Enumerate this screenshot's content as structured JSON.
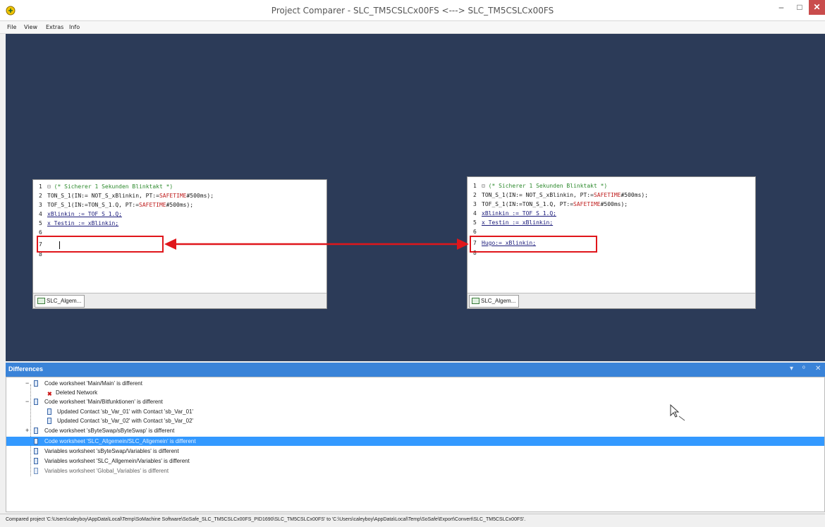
{
  "window": {
    "title": "Project Comparer - SLC_TM5CSLCx00FS <---> SLC_TM5CSLCx00FS",
    "min_icon": "minimize-icon",
    "max_icon": "maximize-icon",
    "close_icon": "close-icon"
  },
  "menu": {
    "items": [
      "File",
      "View",
      "Extras",
      "Info"
    ]
  },
  "left_editor": {
    "tab_label": "SLC_Algem...",
    "lines": [
      {
        "num": "1",
        "fold": "⊟",
        "text": "(* Sicherer 1 Sekunden Blinktakt *)"
      },
      {
        "num": "2",
        "code_a": "TON_S_1(IN:= NOT_S_xBlinkin, PT:=",
        "kw": "SAFETIME",
        "code_b": "#500ms);"
      },
      {
        "num": "3",
        "code_a": "TOF_S_1(IN:=TON_S_1.Q, PT:=",
        "kw": "SAFETIME",
        "code_b": "#500ms);"
      },
      {
        "num": "4",
        "text": "xBlinkin     := TOF_S_1.Q;"
      },
      {
        "num": "5",
        "text": "x_Testin     := xBlinkin;"
      },
      {
        "num": "6",
        "text": ""
      },
      {
        "num": "7",
        "text": ""
      },
      {
        "num": "8",
        "text": ""
      }
    ]
  },
  "right_editor": {
    "tab_label": "SLC_Algem...",
    "lines": [
      {
        "num": "1",
        "fold": "⊟",
        "text": "(* Sicherer 1 Sekunden Blinktakt *)"
      },
      {
        "num": "2",
        "code_a": "TON_S_1(IN:= NOT_S_xBlinkin, PT:=",
        "kw": "SAFETIME",
        "code_b": "#500ms);"
      },
      {
        "num": "3",
        "code_a": "TOF_S_1(IN:=TON_S_1.Q, PT:=",
        "kw": "SAFETIME",
        "code_b": "#500ms);"
      },
      {
        "num": "4",
        "text": "xBlinkin     := TOF_S_1.Q;"
      },
      {
        "num": "5",
        "text": "x_Testin     := xBlinkin;"
      },
      {
        "num": "6",
        "text": ""
      },
      {
        "num": "7",
        "text": "Hugo:= xBlinkin;"
      },
      {
        "num": "8",
        "text": ""
      }
    ]
  },
  "differences": {
    "title": "Differences",
    "controls": [
      "▾",
      "ᵒ",
      "✕"
    ],
    "rows": [
      {
        "toggle": "−",
        "icon": "doc",
        "text": "Code worksheet 'Main/Main' is different"
      },
      {
        "toggle": "",
        "icon": "error",
        "text": "Deleted Network"
      },
      {
        "toggle": "−",
        "icon": "doc",
        "text": "Code worksheet 'Main/Bitfunktionen' is different"
      },
      {
        "toggle": "",
        "icon": "doc",
        "text": "Updated Contact 'sb_Var_01' with Contact 'sb_Var_01'"
      },
      {
        "toggle": "",
        "icon": "doc",
        "text": "Updated Contact 'sb_Var_02' with Contact 'sb_Var_02'"
      },
      {
        "toggle": "+",
        "icon": "doc",
        "text": "Code worksheet 'sByteSwap/sByteSwap' is different"
      },
      {
        "toggle": "",
        "icon": "doc",
        "text": "Code worksheet 'SLC_Allgemein/SLC_Allgemein' is different",
        "selected": true
      },
      {
        "toggle": "",
        "icon": "doc",
        "text": "Variables worksheet 'sByteSwap/Variables' is different"
      },
      {
        "toggle": "",
        "icon": "doc",
        "text": "Variables worksheet 'SLC_Allgemein/Variables' is different"
      },
      {
        "toggle": "",
        "icon": "doc",
        "text": "Variables worksheet 'Global_Variables' is different"
      }
    ]
  },
  "status": {
    "text": "Compared project 'C:\\Users\\caleyboy\\AppData\\Local\\Temp\\SoMachine Software\\SoSafe_SLC_TM5CSLCx00FS_PID1690\\SLC_TM5CSLCx00FS' to 'C:\\Users\\caleyboy\\AppData\\Local\\Temp\\SoSafe\\Export\\Convert\\SLC_TM5CSLCx00FS'."
  },
  "colors": {
    "workspace": "#2c3b58",
    "highlight": "#e0161b",
    "selection": "#3399ff",
    "panel_header": "#3a83d8"
  }
}
